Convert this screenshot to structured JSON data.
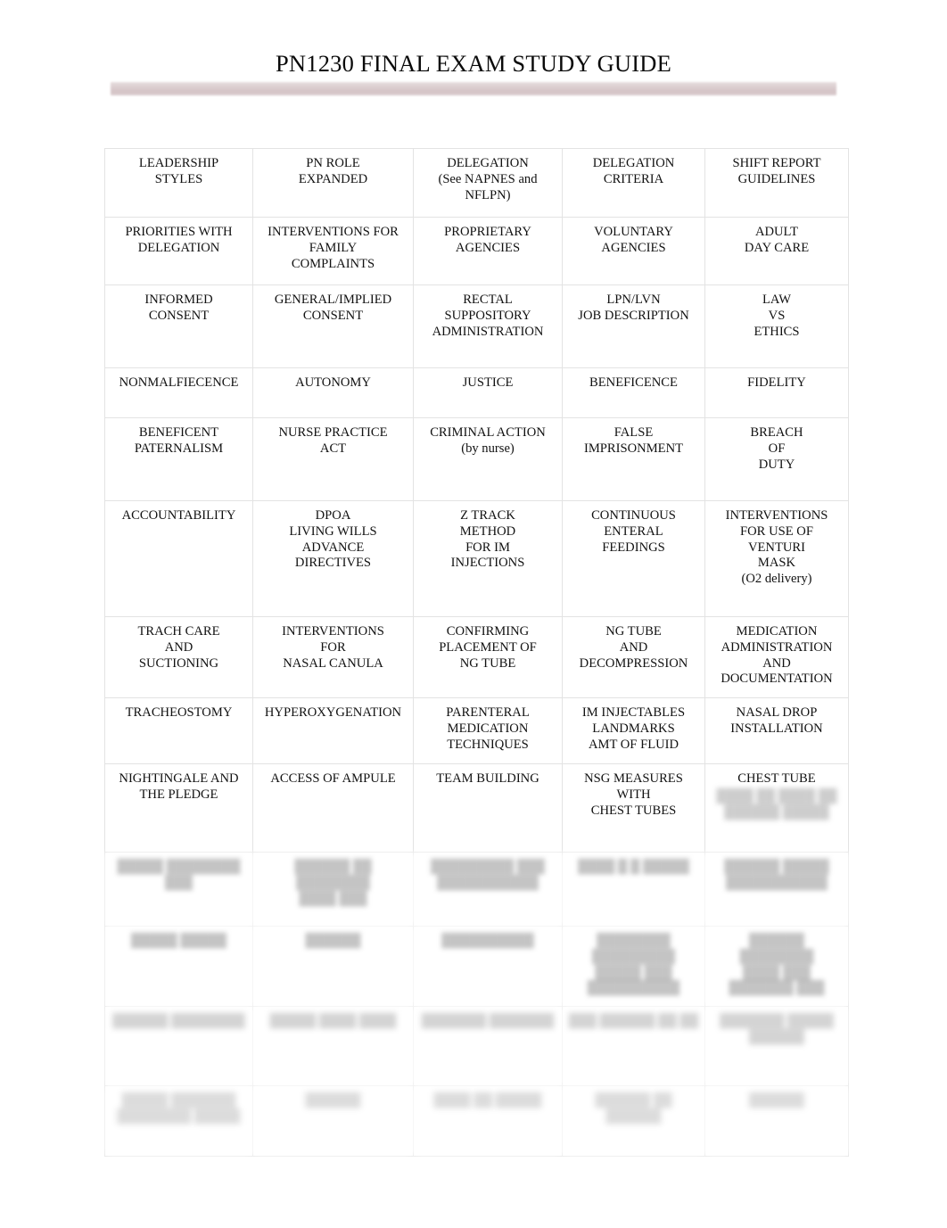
{
  "document": {
    "title": "PN1230 FINAL EXAM STUDY GUIDE",
    "accent_color": "#d3c2c5",
    "text_color": "#111111",
    "border_color": "#e3e3e3",
    "page_background": "#ffffff"
  },
  "table": {
    "columns": 5,
    "rows": [
      {
        "id": "row-1",
        "cells": [
          "LEADERSHIP\nSTYLES",
          "PN ROLE\nEXPANDED",
          "DELEGATION\n(See NAPNES and\nNFLPN)",
          "DELEGATION\nCRITERIA",
          "SHIFT REPORT\nGUIDELINES"
        ]
      },
      {
        "id": "row-2",
        "cells": [
          "PRIORITIES WITH\nDELEGATION",
          "INTERVENTIONS FOR\nFAMILY\nCOMPLAINTS",
          "PROPRIETARY\nAGENCIES",
          "VOLUNTARY\nAGENCIES",
          "ADULT\nDAY CARE"
        ]
      },
      {
        "id": "row-3",
        "cells": [
          "INFORMED\nCONSENT",
          "GENERAL/IMPLIED\nCONSENT",
          "RECTAL\nSUPPOSITORY\nADMINISTRATION",
          "LPN/LVN\nJOB DESCRIPTION",
          "LAW\nVS\nETHICS"
        ]
      },
      {
        "id": "row-4",
        "cells": [
          "NONMALFIECENCE",
          "AUTONOMY",
          "JUSTICE",
          "BENEFICENCE",
          "FIDELITY"
        ]
      },
      {
        "id": "row-5",
        "cells": [
          "BENEFICENT\nPATERNALISM",
          "NURSE PRACTICE\nACT",
          "CRIMINAL ACTION\n(by nurse)",
          "FALSE\nIMPRISONMENT",
          "BREACH\nOF\nDUTY"
        ]
      },
      {
        "id": "row-6",
        "cells": [
          "ACCOUNTABILITY",
          "DPOA\nLIVING WILLS\nADVANCE\nDIRECTIVES",
          "Z TRACK\nMETHOD\nFOR IM\nINJECTIONS",
          "CONTINUOUS\nENTERAL\nFEEDINGS",
          "INTERVENTIONS\nFOR USE OF\nVENTURI\nMASK\n(O2 delivery)"
        ]
      },
      {
        "id": "row-7",
        "cells": [
          "TRACH CARE\nAND\nSUCTIONING",
          "INTERVENTIONS\nFOR\nNASAL CANULA",
          "CONFIRMING\nPLACEMENT OF\nNG TUBE",
          "NG TUBE\nAND\nDECOMPRESSION",
          "MEDICATION\nADMINISTRATION\nAND\nDOCUMENTATION"
        ]
      },
      {
        "id": "row-8",
        "cells": [
          "TRACHEOSTOMY",
          "HYPEROXYGENATION",
          "PARENTERAL\nMEDICATION\nTECHNIQUES",
          "IM INJECTABLES\nLANDMARKS\nAMT OF FLUID",
          "NASAL DROP\nINSTALLATION"
        ]
      },
      {
        "id": "row-9",
        "cells": [
          "NIGHTINGALE AND\nTHE PLEDGE",
          "ACCESS OF AMPULE",
          "TEAM BUILDING",
          "NSG MEASURES\nWITH\nCHEST TUBES",
          "CHEST TUBE"
        ],
        "cell_tails": [
          "",
          "",
          "",
          "",
          "████ ██ ████\n██\n██████ █████"
        ]
      },
      {
        "id": "row-10",
        "state": "faded",
        "cells": [
          "█████ ████████ ███",
          "██████ ██ ████████\n████ ███",
          "█████████ ███\n███████████",
          "████ █ █ █████",
          "██████ █████\n███████████"
        ]
      },
      {
        "id": "row-11",
        "state": "faded",
        "cells": [
          "█████ █████",
          "██████",
          "██████████",
          "████████\n█████████\n█████ ███\n██████████",
          "██████\n████████\n████ ███\n███████ ███"
        ]
      },
      {
        "id": "row-12",
        "state": "faded-strong",
        "cells": [
          "██████ ████████",
          "█████ ████ ████",
          "███████ ███████",
          "███ ██████ ██ ██",
          "███████ █████\n██████"
        ]
      },
      {
        "id": "row-13",
        "state": "faded-max",
        "cells": [
          "█████ ███████\n████████ █████",
          "██████",
          "████ ██ █████",
          "██████ ██ ██████",
          "██████"
        ]
      }
    ]
  }
}
